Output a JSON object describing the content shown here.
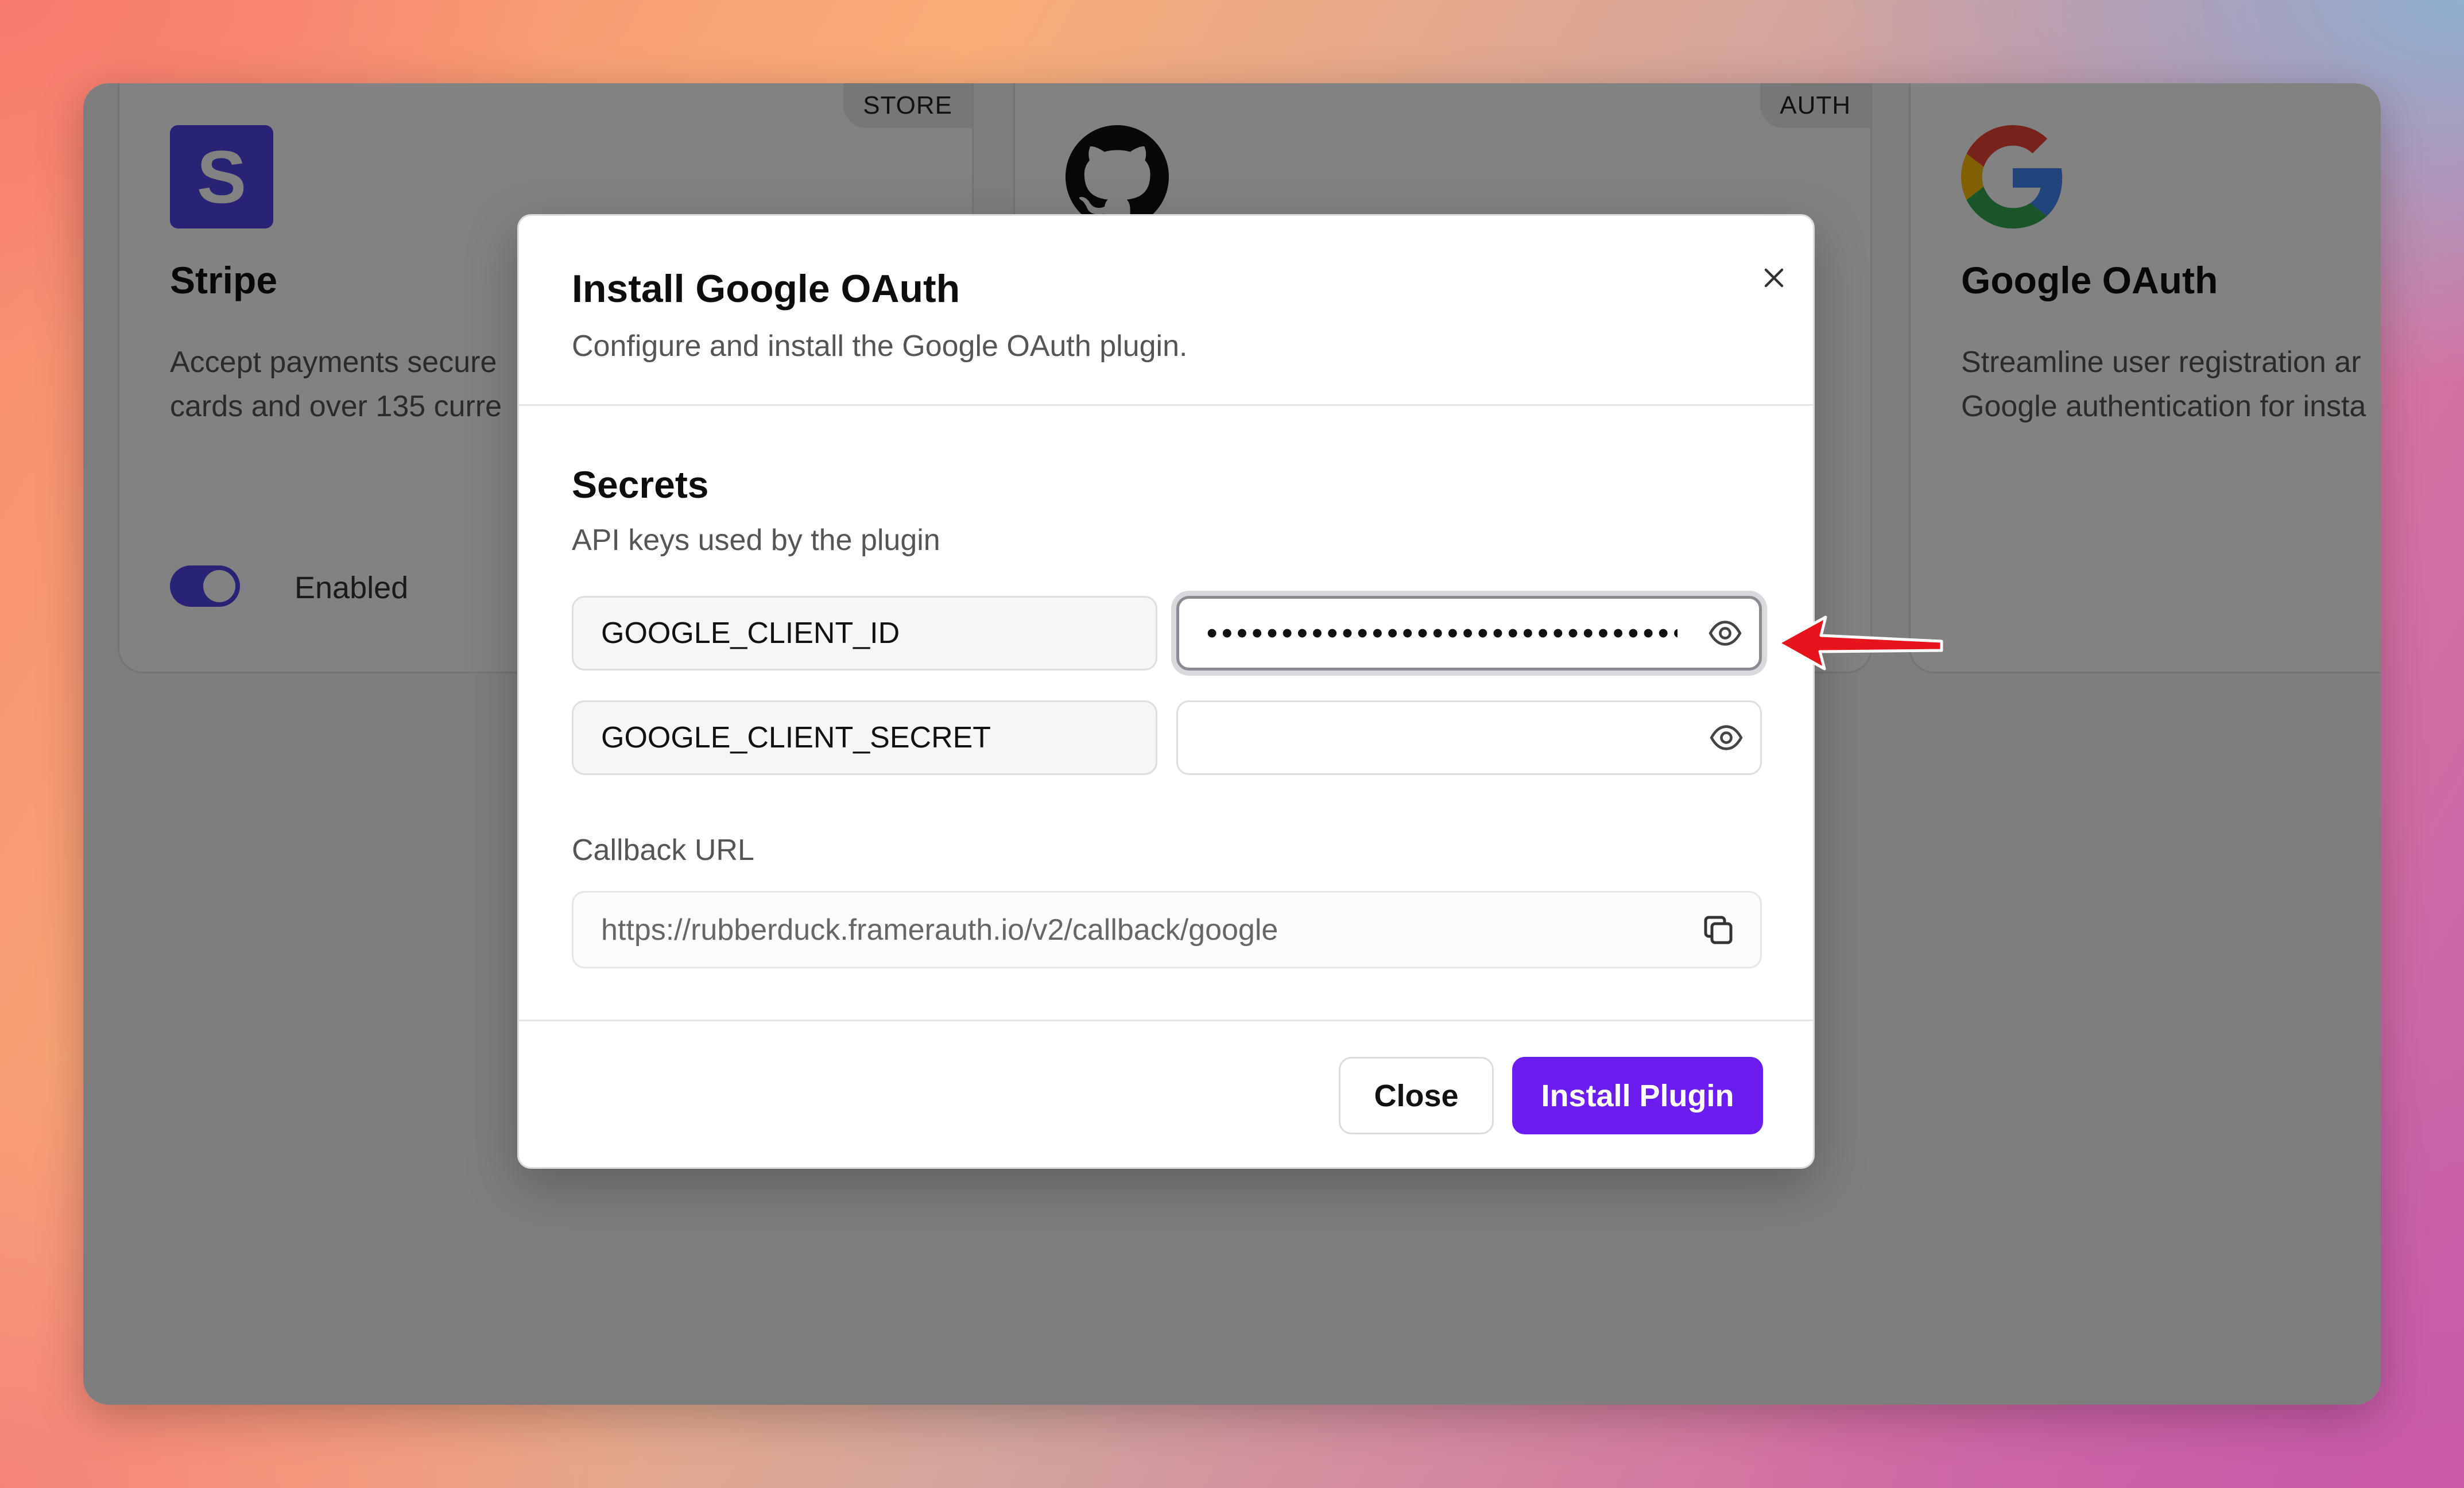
{
  "background_cards": [
    {
      "title": "Stripe",
      "tag": "STORE",
      "description_lines": [
        "Accept payments secure",
        "cards and over 135 curre"
      ],
      "toggle_label": "Enabled",
      "logo_letter": "S",
      "logo_color": "#5046e5"
    },
    {
      "tag": "AUTH",
      "logo_icon": "github-icon"
    },
    {
      "title": "Google OAuth",
      "description_lines": [
        "Streamline user registration ar",
        "Google authentication for insta"
      ],
      "logo_icon": "google-icon"
    }
  ],
  "modal": {
    "title": "Install Google OAuth",
    "subtitle": "Configure and install the Google OAuth plugin.",
    "secrets_title": "Secrets",
    "secrets_subtitle": "API keys used by the plugin",
    "secrets": [
      {
        "key": "GOOGLE_CLIENT_ID",
        "masked_value": "•••••••••••••••••••••••••••••••••",
        "focused": true
      },
      {
        "key": "GOOGLE_CLIENT_SECRET",
        "masked_value": "",
        "focused": false
      }
    ],
    "callback_label": "Callback URL",
    "callback_url": "https://rubberduck.framerauth.io/v2/callback/google",
    "close_button": "Close",
    "install_button": "Install Plugin"
  },
  "colors": {
    "accent_purple": "#6b1df0",
    "stripe_indigo": "#5046e5",
    "annotation_arrow": "#e8141c"
  },
  "icons": [
    "close-icon",
    "eye-icon",
    "copy-icon",
    "github-icon",
    "google-icon",
    "red-arrow"
  ]
}
